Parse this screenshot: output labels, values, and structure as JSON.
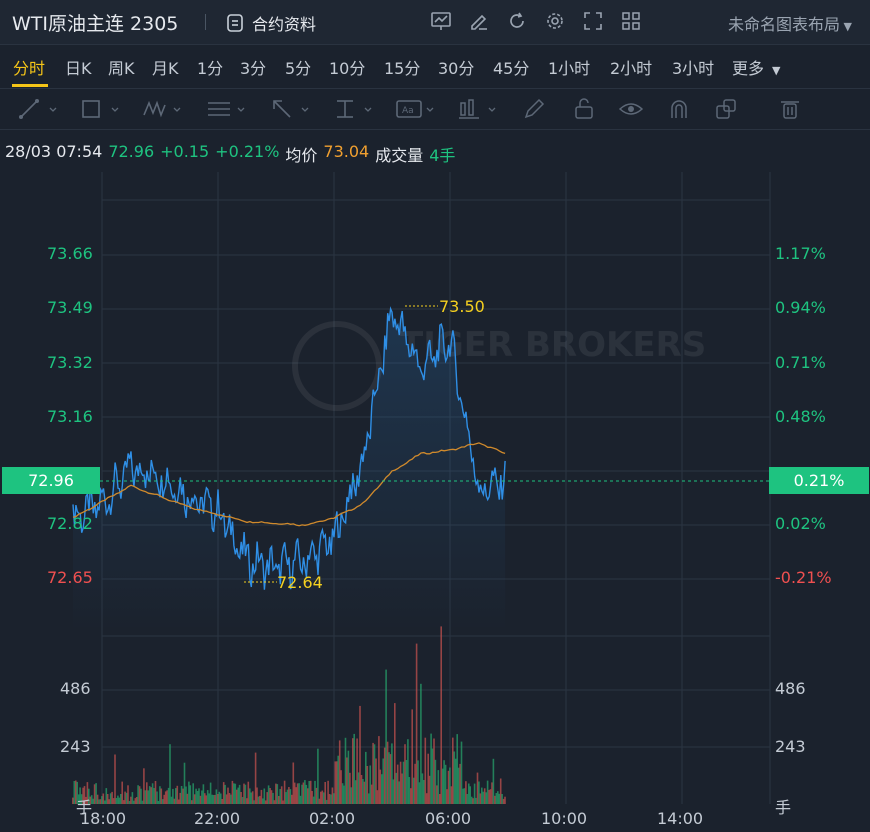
{
  "header": {
    "title": "WTI原油主连 2305",
    "contract_label": "合约资料",
    "layout_label": "未命名图表布局",
    "icons": [
      "chart-settings-icon",
      "edit-icon",
      "refresh-icon",
      "gear-icon",
      "fullscreen-icon",
      "grid-layout-icon"
    ]
  },
  "periods": [
    "分时",
    "日K",
    "周K",
    "月K",
    "1分",
    "3分",
    "5分",
    "10分",
    "15分",
    "30分",
    "45分",
    "1小时",
    "2小时",
    "3小时",
    "更多"
  ],
  "active_period": "分时",
  "info": {
    "datetime": "28/03 07:54",
    "price": "72.96",
    "change": "+0.15",
    "change_pct": "+0.21%",
    "avg_label": "均价",
    "avg_value": "73.04",
    "volume_label": "成交量",
    "volume_value": "4手"
  },
  "watermark": "TIGER BROKERS",
  "current_price_tag": "72.96",
  "current_pct_tag": "0.21%",
  "chart_data": {
    "type": "line",
    "title": "",
    "x_ticks": [
      "18:00",
      "22:00",
      "02:00",
      "06:00",
      "10:00",
      "14:00"
    ],
    "price_ticks": [
      "73.66",
      "73.49",
      "73.32",
      "73.16",
      "72.82",
      "72.65"
    ],
    "pct_ticks": [
      "1.17%",
      "0.94%",
      "0.71%",
      "0.48%",
      "0.02%",
      "-0.21%"
    ],
    "volume_ticks": [
      "486",
      "243"
    ],
    "volume_unit": "手",
    "high_label": "73.50",
    "low_label": "72.64",
    "prev_close": 72.81,
    "ylim": [
      72.54,
      73.83
    ],
    "volume_ylim": [
      0,
      668
    ],
    "series": [
      {
        "name": "",
        "color": "#2f8fe6",
        "x": [
          "17:00",
          "18:00",
          "19:00",
          "20:00",
          "21:00",
          "22:00",
          "23:00",
          "00:00",
          "01:00",
          "02:00",
          "03:00",
          "04:00",
          "05:00",
          "06:00",
          "07:00",
          "07:54"
        ],
        "values": [
          72.86,
          72.9,
          73.0,
          72.98,
          72.92,
          72.88,
          72.74,
          72.72,
          72.74,
          72.8,
          73.02,
          73.44,
          73.28,
          73.36,
          72.94,
          72.96
        ]
      },
      {
        "name": "",
        "color": "#d08a2c",
        "x": [
          "17:00",
          "19:00",
          "21:00",
          "23:00",
          "01:00",
          "02:00",
          "03:00",
          "04:00",
          "05:00",
          "06:00",
          "07:00",
          "07:54"
        ],
        "values": [
          72.86,
          72.95,
          72.89,
          72.85,
          72.84,
          72.86,
          72.9,
          72.99,
          73.04,
          73.05,
          73.07,
          73.04
        ]
      }
    ]
  }
}
